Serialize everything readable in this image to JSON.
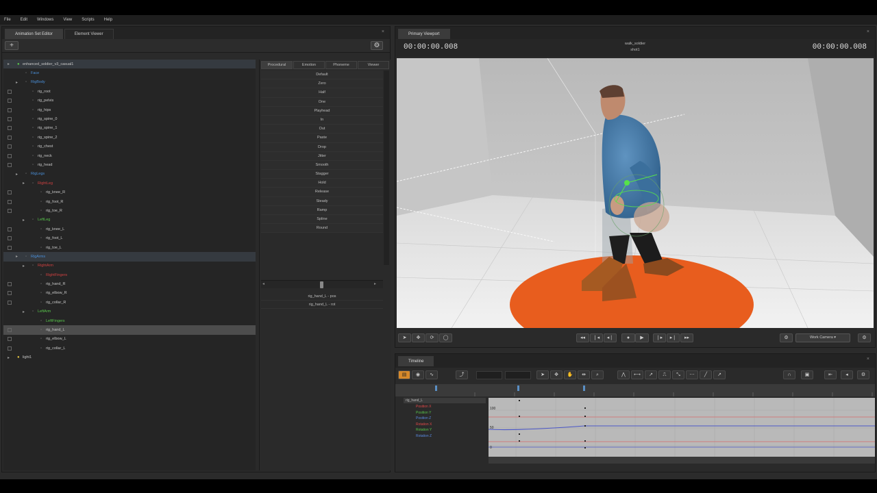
{
  "menu": [
    "File",
    "Edit",
    "Windows",
    "View",
    "Scripts",
    "Help"
  ],
  "left_tabs": [
    "Animation Set Editor",
    "Element Viewer"
  ],
  "add_button": "+",
  "tree": [
    {
      "label": "enhanced_soldier_v3_casual1",
      "color": "white",
      "indent": 0,
      "chk": false,
      "arrow": "▸",
      "hl": true
    },
    {
      "label": "Face",
      "color": "blue",
      "indent": 1,
      "chk": false,
      "arrow": ""
    },
    {
      "label": "RigBody",
      "color": "blue",
      "indent": 1,
      "chk": false,
      "arrow": "▸"
    },
    {
      "label": "rig_root",
      "color": "white",
      "indent": 2,
      "chk": true,
      "arrow": ""
    },
    {
      "label": "rig_pelvis",
      "color": "white",
      "indent": 2,
      "chk": true,
      "arrow": ""
    },
    {
      "label": "rig_hips",
      "color": "white",
      "indent": 2,
      "chk": true,
      "arrow": ""
    },
    {
      "label": "rig_spine_0",
      "color": "white",
      "indent": 2,
      "chk": true,
      "arrow": ""
    },
    {
      "label": "rig_spine_1",
      "color": "white",
      "indent": 2,
      "chk": true,
      "arrow": ""
    },
    {
      "label": "rig_spine_2",
      "color": "white",
      "indent": 2,
      "chk": true,
      "arrow": ""
    },
    {
      "label": "rig_chest",
      "color": "white",
      "indent": 2,
      "chk": true,
      "arrow": ""
    },
    {
      "label": "rig_neck",
      "color": "white",
      "indent": 2,
      "chk": true,
      "arrow": ""
    },
    {
      "label": "rig_head",
      "color": "white",
      "indent": 2,
      "chk": true,
      "arrow": ""
    },
    {
      "label": "RigLegs",
      "color": "blue",
      "indent": 1,
      "chk": false,
      "arrow": "▸"
    },
    {
      "label": "RightLeg",
      "color": "red",
      "indent": 2,
      "chk": false,
      "arrow": "▸"
    },
    {
      "label": "rig_knee_R",
      "color": "white",
      "indent": 3,
      "chk": true,
      "arrow": ""
    },
    {
      "label": "rig_foot_R",
      "color": "white",
      "indent": 3,
      "chk": true,
      "arrow": ""
    },
    {
      "label": "rig_toe_R",
      "color": "white",
      "indent": 3,
      "chk": true,
      "arrow": ""
    },
    {
      "label": "LeftLeg",
      "color": "green",
      "indent": 2,
      "chk": false,
      "arrow": "▸"
    },
    {
      "label": "rig_knee_L",
      "color": "white",
      "indent": 3,
      "chk": true,
      "arrow": ""
    },
    {
      "label": "rig_foot_L",
      "color": "white",
      "indent": 3,
      "chk": true,
      "arrow": ""
    },
    {
      "label": "rig_toe_L",
      "color": "white",
      "indent": 3,
      "chk": true,
      "arrow": ""
    },
    {
      "label": "RigArms",
      "color": "blue",
      "indent": 1,
      "chk": false,
      "arrow": "▸",
      "hl": true
    },
    {
      "label": "RightArm",
      "color": "red",
      "indent": 2,
      "chk": false,
      "arrow": "▸"
    },
    {
      "label": "RightFingers",
      "color": "red",
      "indent": 3,
      "chk": false,
      "arrow": ""
    },
    {
      "label": "rig_hand_R",
      "color": "white",
      "indent": 3,
      "chk": true,
      "arrow": ""
    },
    {
      "label": "rig_elbow_R",
      "color": "white",
      "indent": 3,
      "chk": true,
      "arrow": ""
    },
    {
      "label": "rig_collar_R",
      "color": "white",
      "indent": 3,
      "chk": true,
      "arrow": ""
    },
    {
      "label": "LeftArm",
      "color": "green",
      "indent": 2,
      "chk": false,
      "arrow": "▸"
    },
    {
      "label": "LeftFingers",
      "color": "green",
      "indent": 3,
      "chk": false,
      "arrow": ""
    },
    {
      "label": "rig_hand_L",
      "color": "white",
      "indent": 3,
      "chk": true,
      "arrow": "",
      "selected": true
    },
    {
      "label": "rig_elbow_L",
      "color": "white",
      "indent": 3,
      "chk": true,
      "arrow": ""
    },
    {
      "label": "rig_collar_L",
      "color": "white",
      "indent": 3,
      "chk": true,
      "arrow": ""
    },
    {
      "label": "light1",
      "color": "white",
      "indent": 0,
      "chk": false,
      "arrow": "▸"
    }
  ],
  "procedural": {
    "tabs": [
      "Procedural",
      "Emotion",
      "Phoneme",
      "Viewer"
    ],
    "items": [
      "Default",
      "Zero",
      "Half",
      "One",
      "Playhead",
      "In",
      "Out",
      "Paste",
      "Drop",
      "Jitter",
      "Smooth",
      "Stagger",
      "Hold",
      "Release",
      "Steady",
      "Ramp",
      "Spline",
      "Round"
    ],
    "outputs": [
      "rig_hand_L - pos",
      "rig_hand_L - rot"
    ]
  },
  "viewport": {
    "tab": "Primary Viewport",
    "timecode_left": "00:00:00.008",
    "timecode_right": "00:00:00.008",
    "shot_name": "walk_soldier",
    "shot_sub": "shot1",
    "camera": "Work Camera"
  },
  "timeline": {
    "tab": "Timeline",
    "channels_title": "rig_hand_L",
    "channels": [
      {
        "label": "Position X",
        "color": "#e04848"
      },
      {
        "label": "Position Y",
        "color": "#57c44a"
      },
      {
        "label": "Position Z",
        "color": "#5a8ae0"
      },
      {
        "label": "Rotation X",
        "color": "#e04848"
      },
      {
        "label": "Rotation Y",
        "color": "#57c44a"
      },
      {
        "label": "Rotation Z",
        "color": "#5a8ae0"
      }
    ],
    "graph_labels": [
      "100",
      "50",
      "0"
    ]
  },
  "colors": {
    "blue": "#4a8fd8",
    "red": "#d04040",
    "green": "#59c84c",
    "white": "#c8c8c8",
    "accent": "#d7892a"
  },
  "icons": [
    "gear-icon",
    "play-icon",
    "record-icon",
    "magnet-icon"
  ]
}
